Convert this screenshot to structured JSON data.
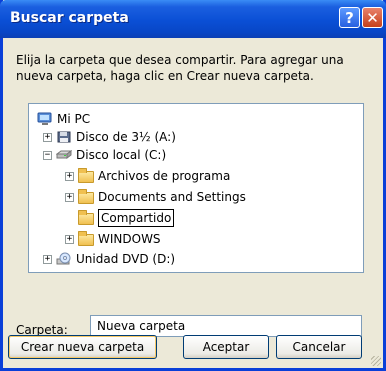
{
  "dialog": {
    "title": "Buscar carpeta",
    "help_label": "?",
    "close_label": "✕",
    "instructions": "Elija la carpeta que desea compartir. Para agregar una nueva carpeta, haga clic en Crear nueva carpeta."
  },
  "tree": {
    "items": [
      {
        "label": "Mi PC",
        "icon": "computer-icon",
        "expander": ""
      },
      {
        "label": "Disco de 3½ (A:)",
        "icon": "floppy-icon",
        "expander": "+"
      },
      {
        "label": "Disco local (C:)",
        "icon": "hard-disk-icon",
        "expander": "−"
      },
      {
        "label": "Archivos de programa",
        "icon": "folder-icon",
        "expander": "+"
      },
      {
        "label": "Documents and Settings",
        "icon": "folder-icon",
        "expander": "+"
      },
      {
        "label": "Compartido",
        "icon": "folder-icon",
        "expander": "",
        "editing": true
      },
      {
        "label": "WINDOWS",
        "icon": "folder-icon",
        "expander": "+"
      },
      {
        "label": "Unidad DVD (D:)",
        "icon": "dvd-icon",
        "expander": "+"
      }
    ]
  },
  "folder_field": {
    "label": "Carpeta:",
    "value": "Nueva carpeta"
  },
  "buttons": {
    "new_folder": "Crear nueva carpeta",
    "accept": "Aceptar",
    "cancel": "Cancelar"
  },
  "colors": {
    "titlebar": "#0a4fd5",
    "dialog_bg": "#ece9d8",
    "close_button": "#c6401a"
  }
}
